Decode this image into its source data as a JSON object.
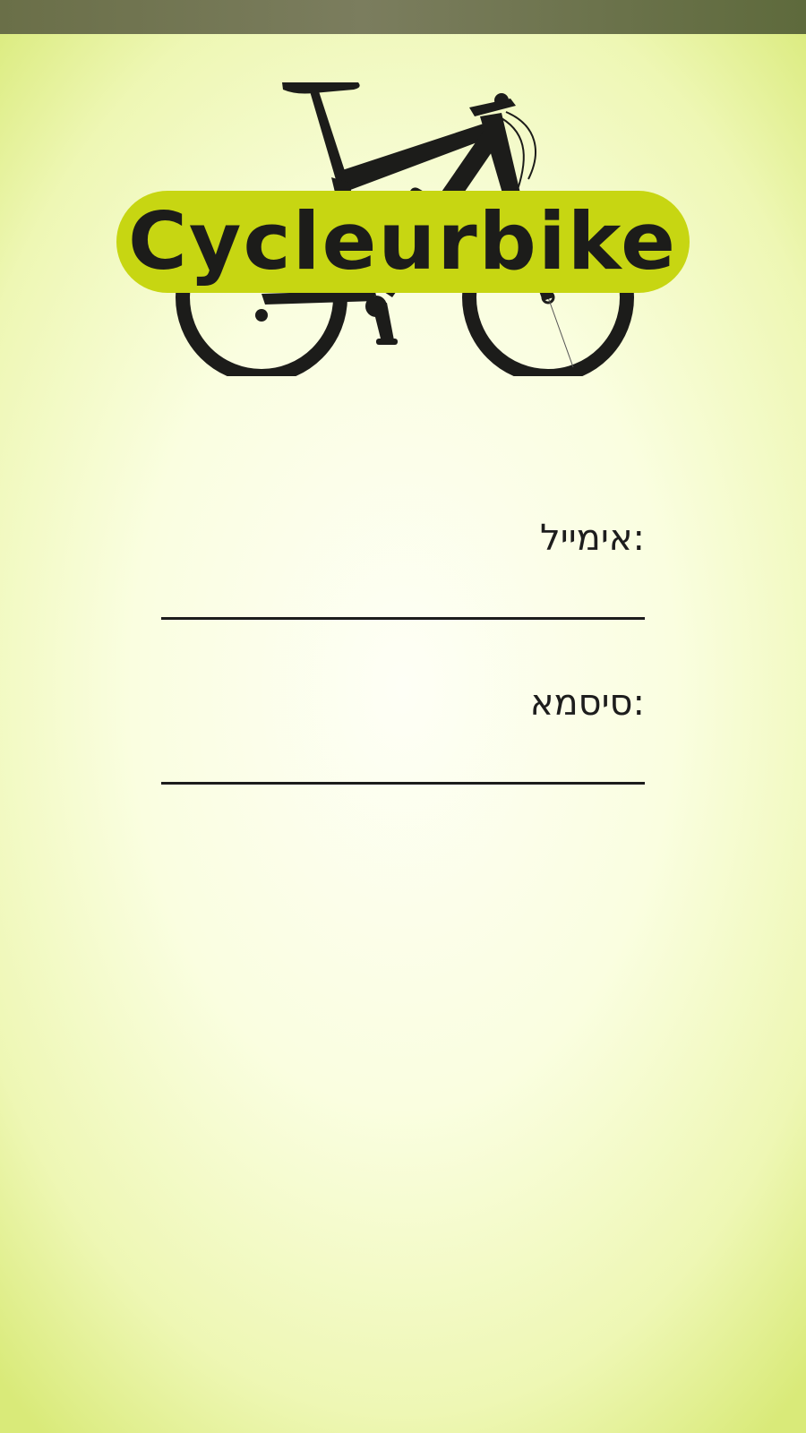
{
  "status_bar": {},
  "logo": {
    "text": "Cycleurbike",
    "icon": "bicycle-icon",
    "colors": {
      "badge": "#c7d612",
      "silhouette": "#1c1c1a"
    }
  },
  "form": {
    "email_label": ":אימייל",
    "email_value": "",
    "password_label": ":סיסמא",
    "password_value": ""
  },
  "colors": {
    "background_center": "#fefff6",
    "background_edge": "#d9ea79",
    "status_bar": "#6f7450",
    "text": "#1d1d1d"
  }
}
